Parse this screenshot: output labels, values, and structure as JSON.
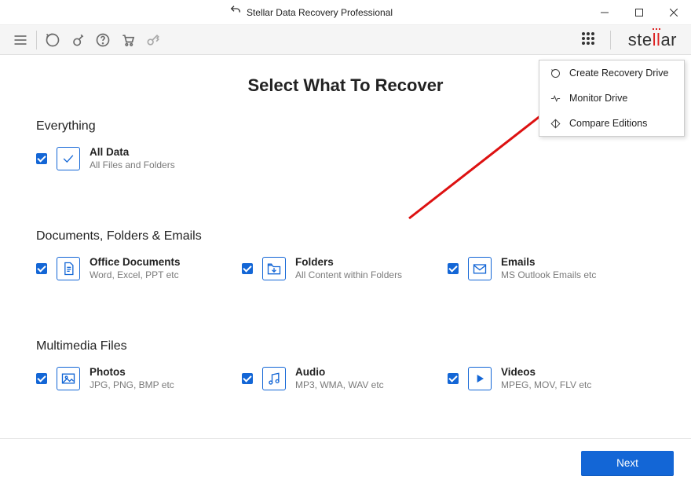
{
  "window": {
    "title": "Stellar Data Recovery Professional"
  },
  "brand": "stellar",
  "page_title": "Select What To Recover",
  "sections": {
    "everything": {
      "heading": "Everything",
      "all_data": {
        "title": "All Data",
        "sub": "All Files and Folders"
      }
    },
    "docs": {
      "heading": "Documents, Folders & Emails",
      "office": {
        "title": "Office Documents",
        "sub": "Word, Excel, PPT etc"
      },
      "folders": {
        "title": "Folders",
        "sub": "All Content within Folders"
      },
      "emails": {
        "title": "Emails",
        "sub": "MS Outlook Emails etc"
      }
    },
    "media": {
      "heading": "Multimedia Files",
      "photos": {
        "title": "Photos",
        "sub": "JPG, PNG, BMP etc"
      },
      "audio": {
        "title": "Audio",
        "sub": "MP3, WMA, WAV etc"
      },
      "videos": {
        "title": "Videos",
        "sub": "MPEG, MOV, FLV etc"
      }
    }
  },
  "dropdown": {
    "items": [
      {
        "label": "Create Recovery Drive"
      },
      {
        "label": "Monitor Drive"
      },
      {
        "label": "Compare Editions"
      }
    ]
  },
  "footer": {
    "next": "Next"
  }
}
